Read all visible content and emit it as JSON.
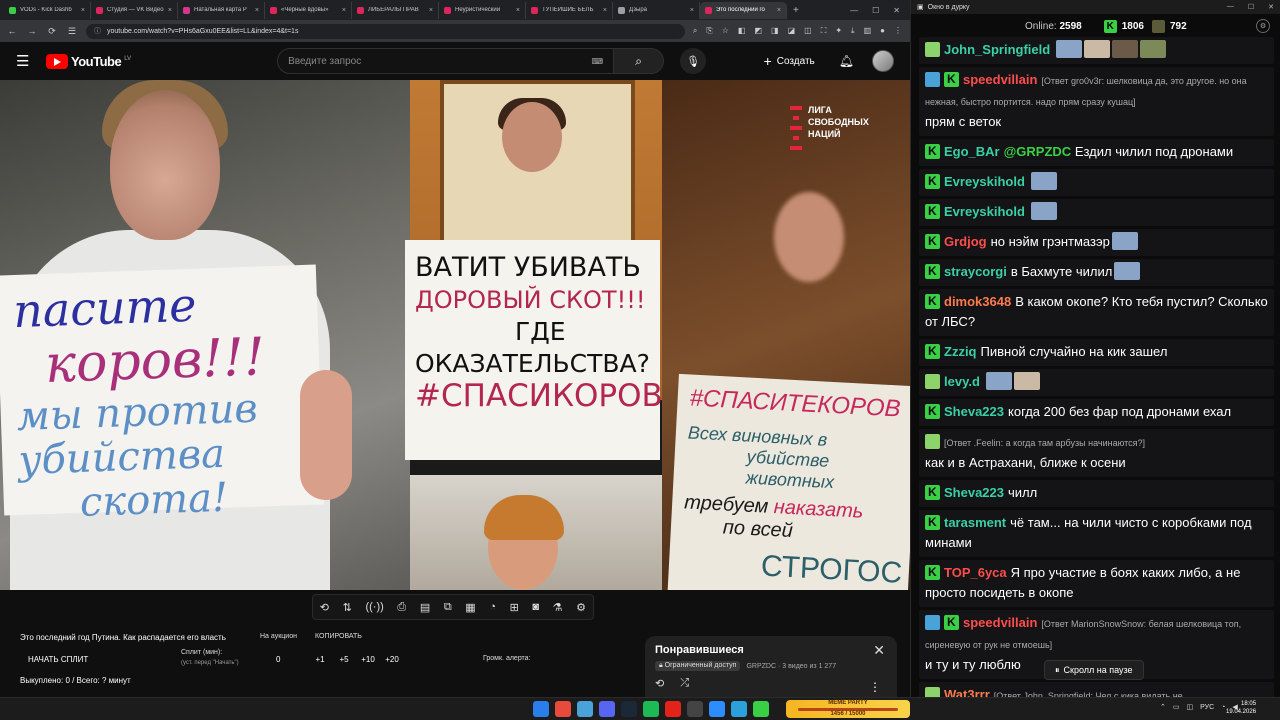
{
  "browser": {
    "tabs": [
      {
        "label": "VODs - Kick Dashb",
        "color": "#3ad046"
      },
      {
        "label": "Студия — VK Видео",
        "color": "#e0245e"
      },
      {
        "label": "Натальная карта Р",
        "color": "#d4368a"
      },
      {
        "label": "«Черные вдовы»",
        "color": "#e0245e"
      },
      {
        "label": "ЛИБЕРАЛЫ ПРАВ",
        "color": "#e0245e"
      },
      {
        "label": "Неуристический",
        "color": "#e0245e"
      },
      {
        "label": "ТУПЕЙШИЕ БЕЛЬ",
        "color": "#e0245e"
      },
      {
        "label": "Дзыра",
        "color": "#9aa0a6"
      },
      {
        "label": "Это последний го",
        "color": "#e0245e"
      }
    ],
    "url": "youtube.com/watch?v=PHs6aGxu0EE&list=LL&index=4&t=1s"
  },
  "youtube": {
    "logo_text": "YouTube",
    "region": "LV",
    "search_placeholder": "Введите запрос",
    "create_label": "Создать"
  },
  "video": {
    "channel_logo": [
      "ЛИГА",
      "СВОБОДНЫХ",
      "НАЦИЙ"
    ],
    "sign1": [
      "пасите",
      "коров!!!",
      "мы против",
      "убийства",
      "скота!"
    ],
    "sign2": [
      "ВАТИТ УБИВАТЬ",
      "ДОРОВЫЙ СКОТ!!!",
      "ГДЕ",
      "ОКАЗАТЕЛЬСТВА?",
      "#СПАСИКОРОВ"
    ],
    "sign3": [
      "#СПАСИТЕКОРОВ",
      "Всех виновных в",
      "убийстве",
      "животных",
      "требуем",
      "наказать",
      "по всей",
      "СТРОГОС"
    ]
  },
  "extension": {
    "video_title": "Это последний год Путина. Как распадается его власть",
    "auction": "На аукцион",
    "copy": "КОПИРОВАТЬ",
    "start_split": "НАЧАТЬ СПЛИТ",
    "split_label": "Сплит (мин):",
    "split_hint": "(уст. перед \"Начать\")",
    "split_values": [
      "0",
      "+1",
      "+5",
      "+10",
      "+20"
    ],
    "volume_label": "Громк. алерта:",
    "bought": "Выкуплено: 0 / Всего: ? минут"
  },
  "liked_panel": {
    "title": "Понравившиеся",
    "access": "Ограниченный доступ",
    "meta": "GRPZDC · 3 видео из 1 277"
  },
  "chat": {
    "window_title": "Окно в дурку",
    "online_label": "Online:",
    "online_count": "2598",
    "kick_count": "1806",
    "rumble_count": "792",
    "messages": [
      {
        "name": "John_Springfield",
        "color": "#3ad0a6",
        "badges": [
          "leaf"
        ],
        "text": "",
        "reply": "",
        "thumbs": 4
      },
      {
        "name": "speedvillain",
        "color": "#ff4d4d",
        "badges": [
          "pen",
          "kick"
        ],
        "reply": "[Ответ gro0v3r: шелковица да, это другое. но она нежная, быстро портится. надо прям сразу кушац]",
        "text": "прям с веток",
        "thumbs": 0
      },
      {
        "name": "Ego_BAr",
        "color": "#3ad0a6",
        "badges": [
          "kick"
        ],
        "reply": "",
        "mention": "@GRPZDC",
        "text": "Ездил чилил под дронами",
        "thumbs": 0
      },
      {
        "name": "Evreyskihold",
        "color": "#3ad0a6",
        "badges": [
          "kick"
        ],
        "reply": "",
        "text": "",
        "thumbs": 1
      },
      {
        "name": "Evreyskihold",
        "color": "#3ad0a6",
        "badges": [
          "kick"
        ],
        "reply": "",
        "text": "",
        "thumbs": 1
      },
      {
        "name": "Grdjog",
        "color": "#ff4d4d",
        "badges": [
          "kick"
        ],
        "reply": "",
        "text": "но нэйм грэнтмазэр",
        "thumbs": 1
      },
      {
        "name": "straycorgi",
        "color": "#3ad0a6",
        "badges": [
          "kick"
        ],
        "reply": "",
        "text": "в Бахмуте чилил",
        "thumbs": 1
      },
      {
        "name": "dimok3648",
        "color": "#ff7a4d",
        "badges": [
          "kick"
        ],
        "reply": "",
        "text": "В каком окопе? Кто тебя пустил? Сколько от ЛБС?",
        "thumbs": 0
      },
      {
        "name": "Zzziq",
        "color": "#3ad0a6",
        "badges": [
          "kick"
        ],
        "reply": "",
        "text": "Пивной случайно на кик зашел",
        "thumbs": 0
      },
      {
        "name": "levy.d",
        "color": "#3ad0a6",
        "badges": [
          "leaf"
        ],
        "reply": "",
        "text": "",
        "thumbs": 2
      },
      {
        "name": "Sheva223",
        "color": "#3ad0a6",
        "badges": [
          "kick"
        ],
        "reply": "",
        "text": "когда 200 без фар под дронами ехал",
        "thumbs": 0
      },
      {
        "name": "",
        "color": "#4aa3d8",
        "badges": [
          "leaf"
        ],
        "reply": "[Ответ .Feelin: а когда там арбузы начинаются?]",
        "text": "как и в Астрахани, ближе к осени",
        "thumbs": 0
      },
      {
        "name": "Sheva223",
        "color": "#3ad0a6",
        "badges": [
          "kick"
        ],
        "reply": "",
        "text": "чилл",
        "thumbs": 0
      },
      {
        "name": "tarasment",
        "color": "#3ad0a6",
        "badges": [
          "kick"
        ],
        "reply": "",
        "text": "чё там... на чили чисто с коробками под минами",
        "thumbs": 0
      },
      {
        "name": "TOP_6yca",
        "color": "#ff4d4d",
        "badges": [
          "kick"
        ],
        "reply": "",
        "text": "Я про участие в боях каких либо, а не просто посидеть в окопе",
        "thumbs": 0
      },
      {
        "name": "speedvillain",
        "color": "#ff4d4d",
        "badges": [
          "pen",
          "kick"
        ],
        "reply": "[Ответ MarionSnowSnow: белая шелковица топ, сиреневую от рук не отмоешь]",
        "text": "и ту и ту люблю",
        "thumbs": 0
      },
      {
        "name": "Wat3rrr",
        "color": "#ff7a4d",
        "badges": [
          "leaf"
        ],
        "reply": "[Ответ John_Springfield: Чел с кика видать не",
        "text": "",
        "thumbs": 0
      }
    ],
    "pause_label": "Скролл на паузе"
  },
  "taskbar": {
    "meme_label": "MEME PARTY",
    "meme_progress": "1456 / 15000",
    "lang": "РУС",
    "time": "18:05",
    "date": "19.04.2026"
  }
}
